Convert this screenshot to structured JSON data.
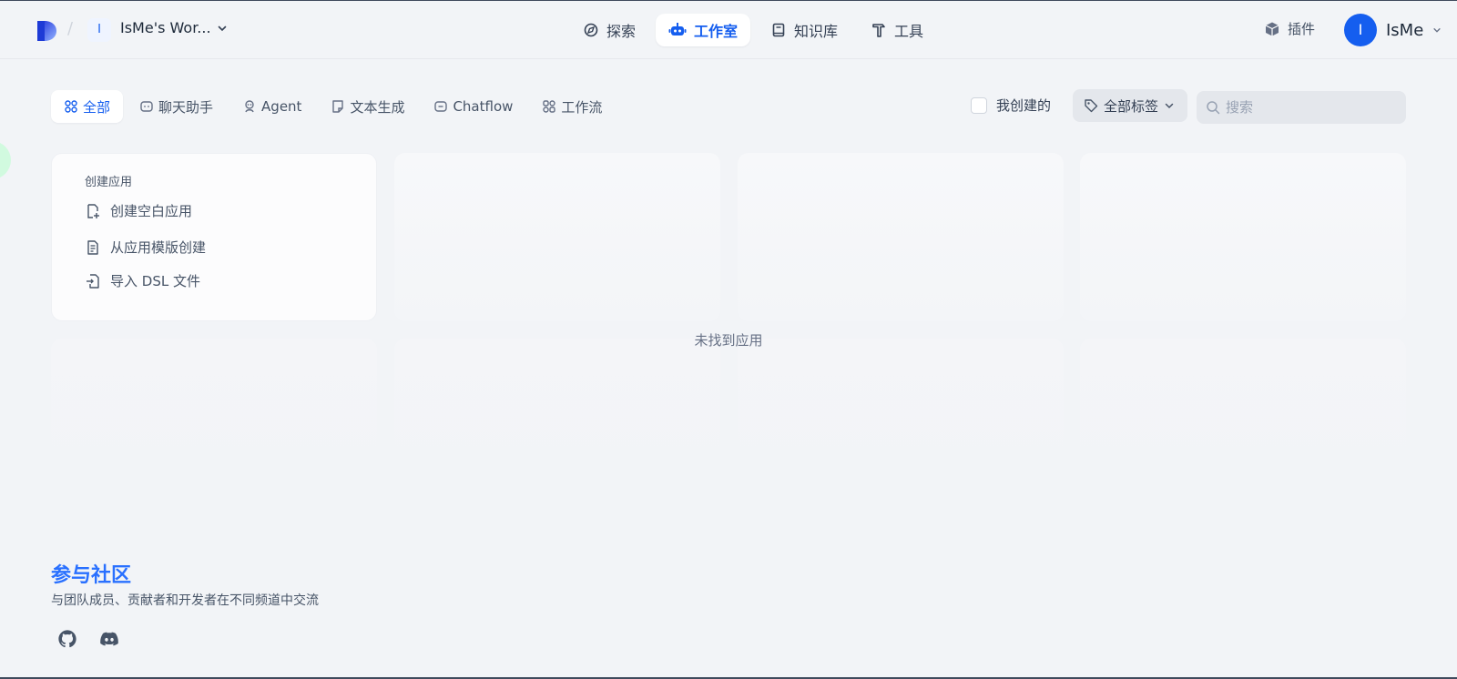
{
  "header": {
    "logo_icon": "dify-logo-icon",
    "workspace_initial": "I",
    "workspace_name": "IsMe's Wor...",
    "nav": [
      {
        "label": "探索",
        "icon": "compass-icon"
      },
      {
        "label": "工作室",
        "icon": "robot-icon",
        "active": true
      },
      {
        "label": "知识库",
        "icon": "book-icon"
      },
      {
        "label": "工具",
        "icon": "hammer-icon"
      }
    ],
    "plugin_label": "插件",
    "account_initial": "I",
    "account_name": "IsMe"
  },
  "filters": {
    "tabs": [
      {
        "label": "全部",
        "icon": "grid-icon",
        "active": true
      },
      {
        "label": "聊天助手",
        "icon": "chat-bot-icon"
      },
      {
        "label": "Agent",
        "icon": "agent-icon"
      },
      {
        "label": "文本生成",
        "icon": "document-icon"
      },
      {
        "label": "Chatflow",
        "icon": "chatflow-icon"
      },
      {
        "label": "工作流",
        "icon": "workflow-icon"
      }
    ],
    "mine_label": "我创建的",
    "tag_label": "全部标签",
    "search_placeholder": "搜索"
  },
  "create_card": {
    "title": "创建应用",
    "items": [
      {
        "label": "创建空白应用",
        "icon": "file-plus-icon"
      },
      {
        "label": "从应用模版创建",
        "icon": "file-template-icon"
      },
      {
        "label": "导入 DSL 文件",
        "icon": "file-import-icon"
      }
    ]
  },
  "empty_message": "未找到应用",
  "community": {
    "title": "参与社区",
    "description": "与团队成员、贡献者和开发者在不同频道中交流",
    "links": [
      {
        "icon": "github-icon"
      },
      {
        "icon": "discord-icon"
      }
    ]
  },
  "colors": {
    "accent": "#155eef",
    "background": "#f2f4f7",
    "community_title": "#2970ff"
  }
}
